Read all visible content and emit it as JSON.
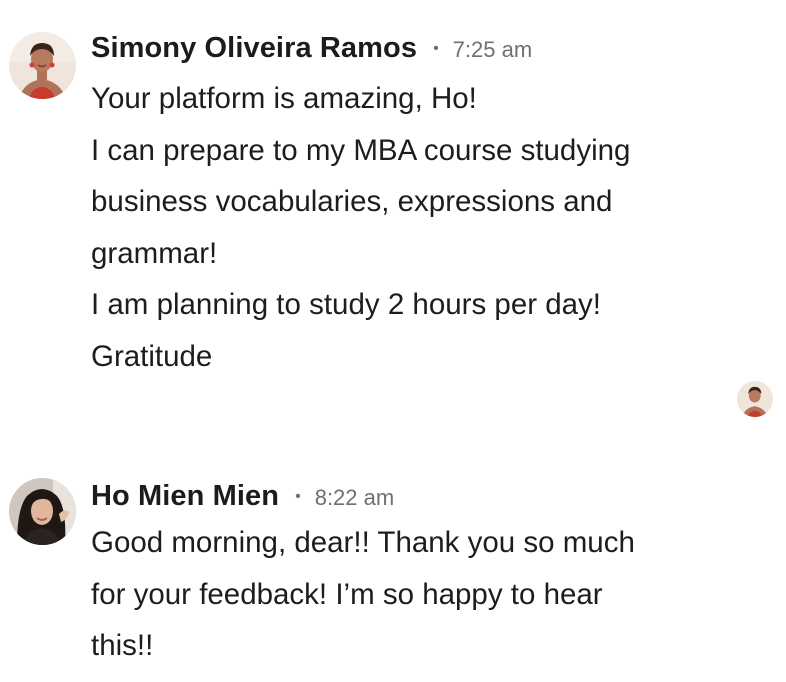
{
  "messages": [
    {
      "author": "Simony Oliveira Ramos",
      "separator": "•",
      "time": "7:25 am",
      "avatar": "avatar-woman-red-top",
      "lines": [
        "Your platform is amazing, Ho!",
        "I can prepare to my MBA course studying",
        "business vocabularies, expressions and",
        "grammar!",
        "I am planning to study 2 hours per day!",
        "Gratitude"
      ]
    },
    {
      "author": "Ho Mien Mien",
      "separator": "•",
      "time": "8:22 am",
      "avatar": "avatar-woman-dark-hair",
      "lines": [
        "Good morning, dear!! Thank you so much",
        "for your feedback! I’m so happy to hear",
        "this!!"
      ]
    }
  ],
  "colors": {
    "text": "#1d1d1d",
    "meta": "#707070",
    "background": "#ffffff"
  }
}
